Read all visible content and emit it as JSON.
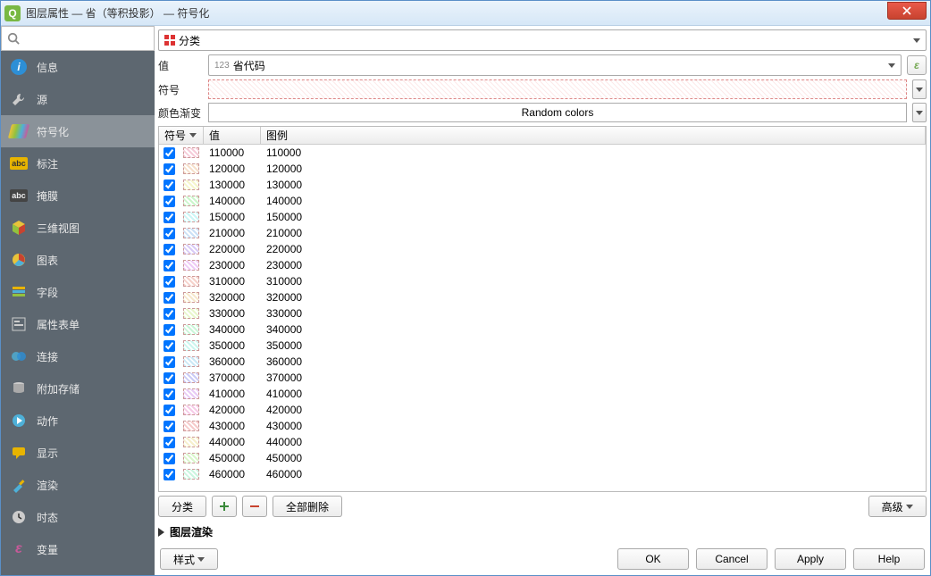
{
  "window": {
    "title": "图层属性 — 省（等积投影） — 符号化"
  },
  "sidebar": {
    "items": [
      {
        "label": "信息"
      },
      {
        "label": "源"
      },
      {
        "label": "符号化"
      },
      {
        "label": "标注"
      },
      {
        "label": "掩膜"
      },
      {
        "label": "三维视图"
      },
      {
        "label": "图表"
      },
      {
        "label": "字段"
      },
      {
        "label": "属性表单"
      },
      {
        "label": "连接"
      },
      {
        "label": "附加存储"
      },
      {
        "label": "动作"
      },
      {
        "label": "显示"
      },
      {
        "label": "渲染"
      },
      {
        "label": "时态"
      },
      {
        "label": "变量"
      }
    ]
  },
  "main": {
    "renderer": "分类",
    "value_label": "值",
    "value_prefix": "123",
    "value_field": "省代码",
    "symbol_label": "符号",
    "ramp_label": "颜色渐变",
    "ramp_name": "Random colors",
    "grid_headers": {
      "symbol": "符号",
      "value": "值",
      "legend": "图例"
    },
    "rows": [
      {
        "value": "110000",
        "legend": "110000"
      },
      {
        "value": "120000",
        "legend": "120000"
      },
      {
        "value": "130000",
        "legend": "130000"
      },
      {
        "value": "140000",
        "legend": "140000"
      },
      {
        "value": "150000",
        "legend": "150000"
      },
      {
        "value": "210000",
        "legend": "210000"
      },
      {
        "value": "220000",
        "legend": "220000"
      },
      {
        "value": "230000",
        "legend": "230000"
      },
      {
        "value": "310000",
        "legend": "310000"
      },
      {
        "value": "320000",
        "legend": "320000"
      },
      {
        "value": "330000",
        "legend": "330000"
      },
      {
        "value": "340000",
        "legend": "340000"
      },
      {
        "value": "350000",
        "legend": "350000"
      },
      {
        "value": "360000",
        "legend": "360000"
      },
      {
        "value": "370000",
        "legend": "370000"
      },
      {
        "value": "410000",
        "legend": "410000"
      },
      {
        "value": "420000",
        "legend": "420000"
      },
      {
        "value": "430000",
        "legend": "430000"
      },
      {
        "value": "440000",
        "legend": "440000"
      },
      {
        "value": "450000",
        "legend": "450000"
      },
      {
        "value": "460000",
        "legend": "460000"
      }
    ],
    "classify_btn": "分类",
    "delete_all_btn": "全部删除",
    "advanced_btn": "高级",
    "layer_rendering": "图层渲染",
    "style_btn": "样式"
  },
  "footer": {
    "ok": "OK",
    "cancel": "Cancel",
    "apply": "Apply",
    "help": "Help"
  }
}
